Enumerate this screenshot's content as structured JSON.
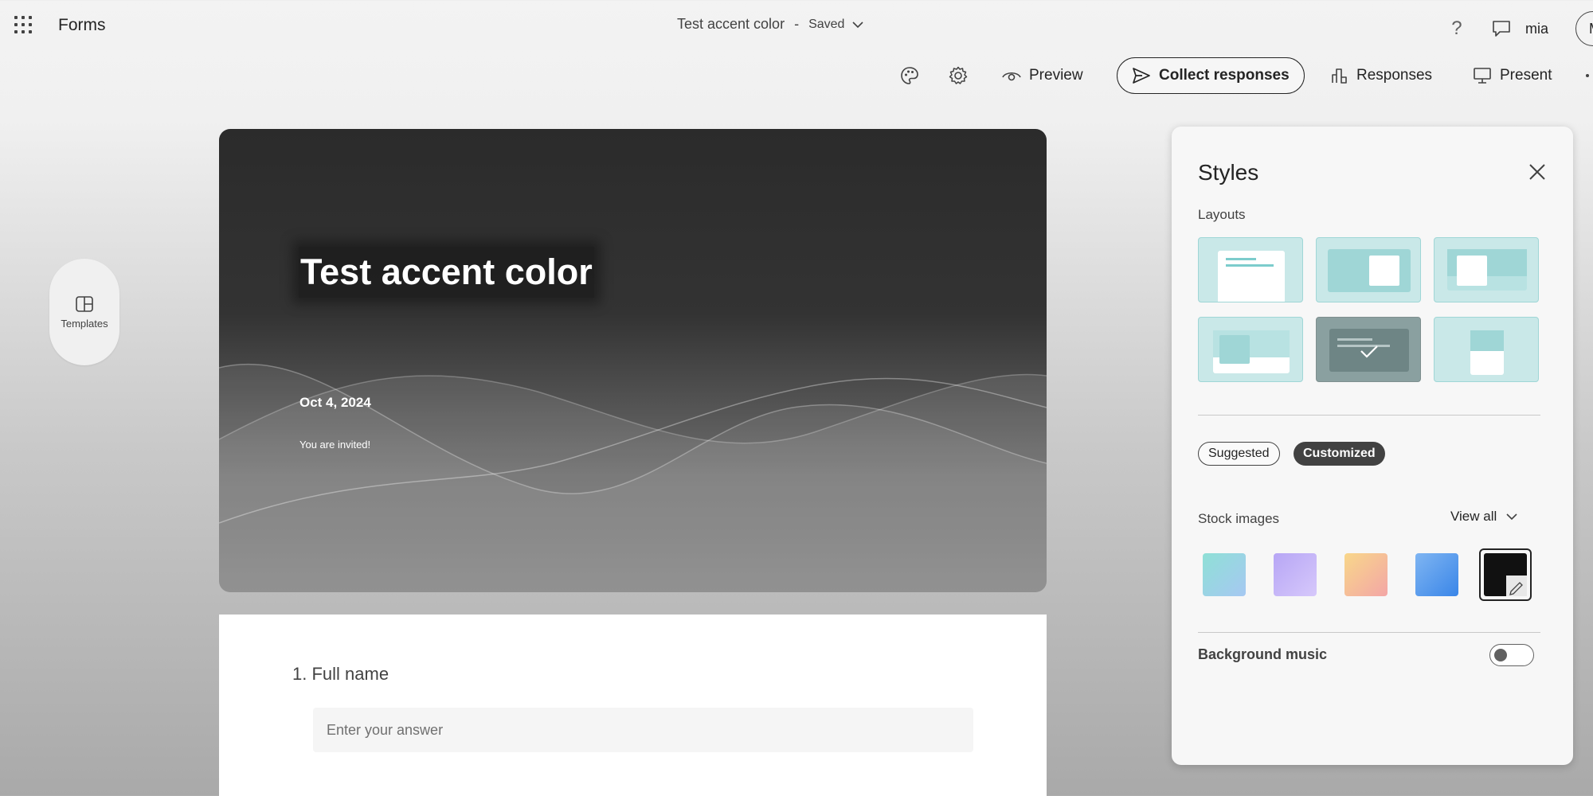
{
  "app": {
    "name": "Forms"
  },
  "document": {
    "title": "Test accent color",
    "separator": "-",
    "save_status": "Saved"
  },
  "user": {
    "name": "mia",
    "avatar_initial": "M"
  },
  "header_icons": {
    "help": "?"
  },
  "toolbar": {
    "theme_icon": "palette-icon",
    "settings_icon": "gear-icon",
    "preview_label": "Preview",
    "collect_label": "Collect responses",
    "responses_label": "Responses",
    "present_label": "Present",
    "more_icon": "more-icon"
  },
  "sidebar": {
    "templates_label": "Templates"
  },
  "form": {
    "title": "Test accent color",
    "date": "Oct 4, 2024",
    "subtitle": "You are invited!",
    "questions": [
      {
        "number": "1.",
        "label": "Full name",
        "placeholder": "Enter your answer"
      }
    ]
  },
  "styles_panel": {
    "title": "Styles",
    "layouts_label": "Layouts",
    "selected_layout_index": 4,
    "tabs": [
      {
        "label": "Suggested",
        "active": false
      },
      {
        "label": "Customized",
        "active": true
      }
    ],
    "stock_images_label": "Stock images",
    "view_all_label": "View all",
    "swatches": [
      {
        "name": "teal-blue-gradient",
        "from": "#8fe0d6",
        "to": "#a6c8f2"
      },
      {
        "name": "violet-gradient",
        "from": "#b7a6f5",
        "to": "#d6c8fb"
      },
      {
        "name": "peach-gradient",
        "from": "#f8d78a",
        "to": "#f3a6a6"
      },
      {
        "name": "blue-gradient",
        "from": "#7fb5f2",
        "to": "#3a86e8"
      }
    ],
    "custom_swatch": {
      "color": "#111111",
      "selected": true
    },
    "background_music_label": "Background music",
    "background_music_on": false
  },
  "colors": {
    "accent_teal": "#c9e8e8",
    "dark": "#242424"
  }
}
